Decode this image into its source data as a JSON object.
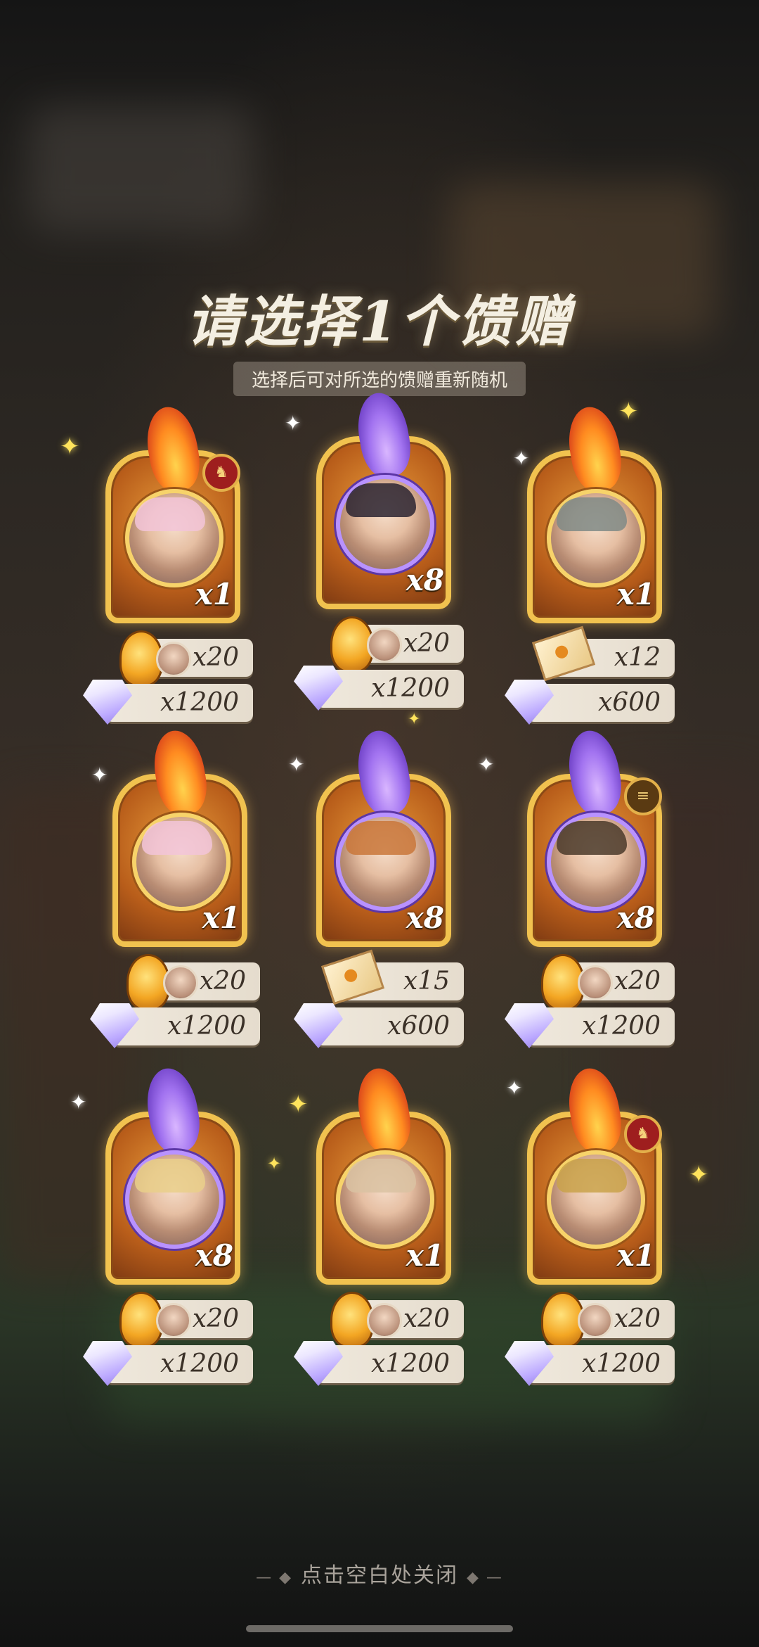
{
  "dialog": {
    "title": "请选择1个馈赠",
    "subtitle": "选择后可对所选的馈赠重新随机",
    "close_hint": "点击空白处关闭"
  },
  "gifts": [
    {
      "theme": "fire",
      "hero": "pink-haired boy",
      "multiplier": "x1",
      "currency_qty": "x20",
      "gem_qty": "x1200",
      "badge": "rank"
    },
    {
      "theme": "purple",
      "hero": "dark-haired pale man",
      "multiplier": "x8",
      "currency_qty": "x20",
      "gem_qty": "x1200",
      "badge": ""
    },
    {
      "theme": "fire",
      "hero": "pale grey-haired lady",
      "multiplier": "x1",
      "currency_qty": "x12",
      "gem_qty": "x600",
      "badge": "",
      "currency_type": "letter"
    },
    {
      "theme": "fire",
      "hero": "pink-haired boy",
      "multiplier": "x1",
      "currency_qty": "x20",
      "gem_qty": "x1200",
      "badge": ""
    },
    {
      "theme": "purple",
      "hero": "auburn-haired youth",
      "multiplier": "x8",
      "currency_qty": "x15",
      "gem_qty": "x600",
      "badge": "",
      "currency_type": "letter"
    },
    {
      "theme": "purple",
      "hero": "masked warrior",
      "multiplier": "x8",
      "currency_qty": "x20",
      "gem_qty": "x1200",
      "badge": "rank"
    },
    {
      "theme": "purple",
      "hero": "blonde crowned lady",
      "multiplier": "x8",
      "currency_qty": "x20",
      "gem_qty": "x1200",
      "badge": ""
    },
    {
      "theme": "fire",
      "hero": "fox-eared girl",
      "multiplier": "x1",
      "currency_qty": "x20",
      "gem_qty": "x1200",
      "badge": ""
    },
    {
      "theme": "fire",
      "hero": "bearded crowned king",
      "multiplier": "x1",
      "currency_qty": "x20",
      "gem_qty": "x1200",
      "badge": "rank"
    }
  ],
  "colors": {
    "fire_frame": "#e79a3a",
    "purple_glow": "#a273f0",
    "gold_border": "#f1c24f",
    "row_bg": "#efe8dc"
  }
}
